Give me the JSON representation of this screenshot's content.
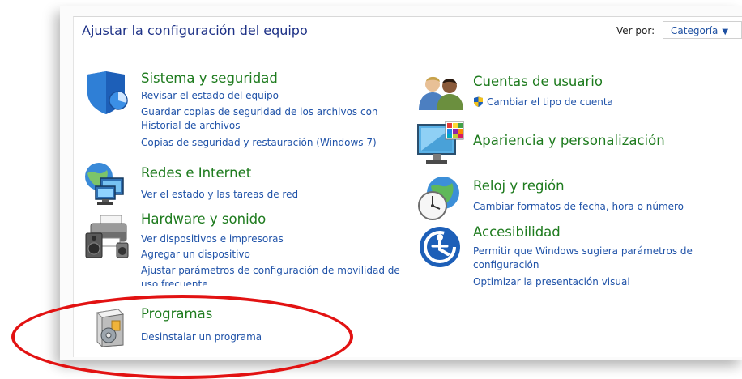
{
  "header": {
    "title": "Ajustar la configuración del equipo",
    "view_by_label": "Ver por:",
    "view_by_value": "Categoría"
  },
  "categories": {
    "system": {
      "title": "Sistema y seguridad",
      "links": [
        "Revisar el estado del equipo",
        "Guardar copias de seguridad de los archivos con",
        "Historial de archivos",
        "Copias de seguridad y restauración (Windows 7)"
      ]
    },
    "network": {
      "title": "Redes e Internet",
      "links": [
        "Ver el estado y las tareas de red"
      ]
    },
    "hardware": {
      "title": "Hardware y sonido",
      "links": [
        "Ver dispositivos e impresoras",
        "Agregar un dispositivo",
        "Ajustar parámetros de configuración de movilidad de",
        "uso frecuente"
      ]
    },
    "programs": {
      "title": "Programas",
      "links": [
        "Desinstalar un programa"
      ]
    },
    "users": {
      "title": "Cuentas de usuario",
      "links": [
        "Cambiar el tipo de cuenta"
      ]
    },
    "appearance": {
      "title": "Apariencia y personalización",
      "links": []
    },
    "clock": {
      "title": "Reloj y región",
      "links": [
        "Cambiar formatos de fecha, hora o número"
      ]
    },
    "accessibility": {
      "title": "Accesibilidad",
      "links": [
        "Permitir que Windows sugiera parámetros de",
        "configuración",
        "Optimizar la presentación visual"
      ]
    }
  },
  "icons": {
    "system": "shield-icon",
    "network": "network-globe-icon",
    "hardware": "printer-speaker-icon",
    "programs": "program-box-icon",
    "users": "users-icon",
    "appearance": "monitor-icon",
    "clock": "clock-globe-icon",
    "accessibility": "accessibility-icon",
    "uac": "uac-shield-icon"
  },
  "colors": {
    "category_title": "#1e7b1e",
    "link": "#1f52a8",
    "header_title": "#1e3287",
    "highlight_circle": "#e21212"
  }
}
